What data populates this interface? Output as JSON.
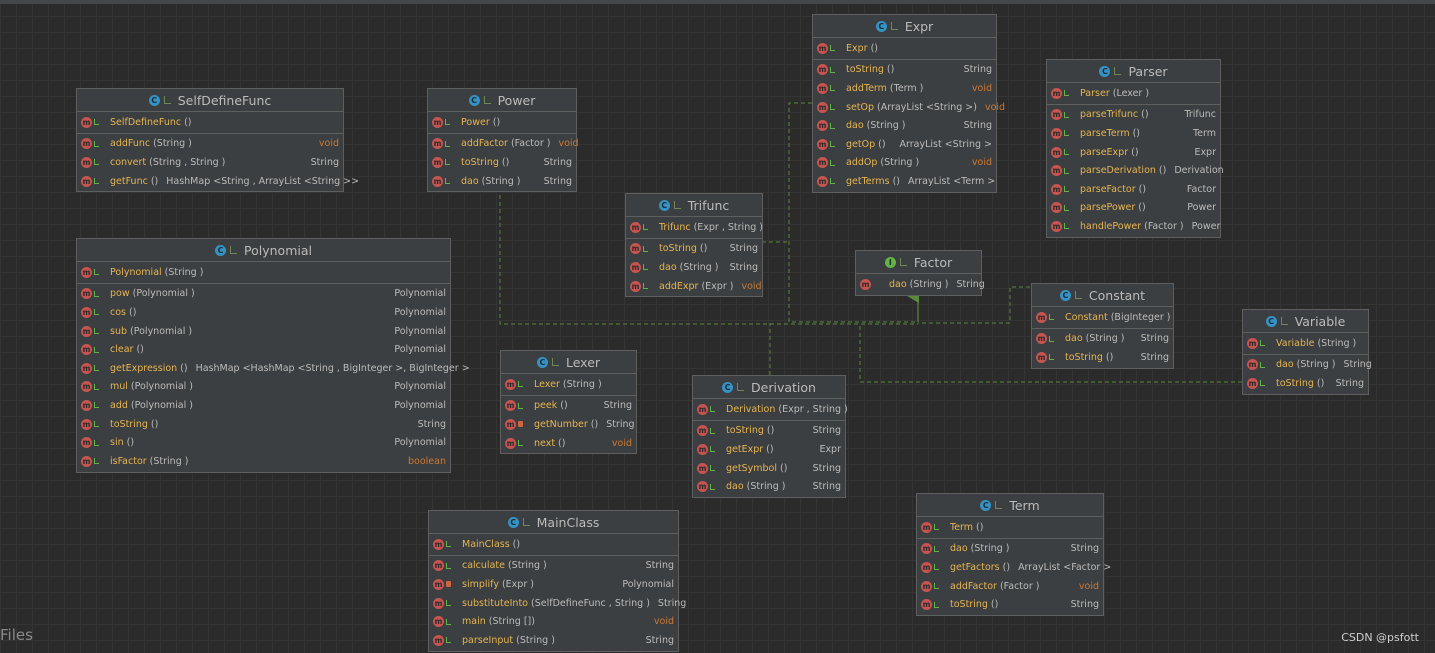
{
  "footer": {
    "left_label": "Files",
    "watermark": "CSDN @psfott"
  },
  "colors": {
    "canvas": "#2b2b2b",
    "node": "#3c3f41",
    "method_name": "#e6b450",
    "void_return": "#cc7832",
    "class_badge": "#3592c4",
    "interface_badge": "#62b543",
    "edge": "#5a8a3c"
  },
  "classes": [
    {
      "id": "selfdefinefunc",
      "kind": "C",
      "name": "SelfDefineFunc",
      "ctor": [
        {
          "name": "SelfDefineFunc",
          "sig": "()",
          "ret": "",
          "acc": "pub"
        }
      ],
      "methods": [
        {
          "name": "addFunc",
          "sig": "(String )",
          "ret": "void",
          "acc": "pub"
        },
        {
          "name": "convert",
          "sig": "(String , String )",
          "ret": "String",
          "acc": "pub"
        },
        {
          "name": "getFunc",
          "sig": "()",
          "ret": "HashMap <String , ArrayList <String >>",
          "acc": "pub"
        }
      ]
    },
    {
      "id": "power",
      "kind": "C",
      "name": "Power",
      "ctor": [
        {
          "name": "Power",
          "sig": "()",
          "ret": "",
          "acc": "pub"
        }
      ],
      "methods": [
        {
          "name": "addFactor",
          "sig": "(Factor )",
          "ret": "void",
          "acc": "pub"
        },
        {
          "name": "toString",
          "sig": "()",
          "ret": "String",
          "acc": "pub"
        },
        {
          "name": "dao",
          "sig": "(String )",
          "ret": "String",
          "acc": "pub"
        }
      ]
    },
    {
      "id": "expr",
      "kind": "C",
      "name": "Expr",
      "ctor": [
        {
          "name": "Expr",
          "sig": "()",
          "ret": "",
          "acc": "pub"
        }
      ],
      "methods": [
        {
          "name": "toString",
          "sig": "()",
          "ret": "String",
          "acc": "pub"
        },
        {
          "name": "addTerm",
          "sig": "(Term )",
          "ret": "void",
          "acc": "pub"
        },
        {
          "name": "setOp",
          "sig": "(ArrayList <String >)",
          "ret": "void",
          "acc": "pub"
        },
        {
          "name": "dao",
          "sig": "(String )",
          "ret": "String",
          "acc": "pub"
        },
        {
          "name": "getOp",
          "sig": "()",
          "ret": "ArrayList <String >",
          "acc": "pub"
        },
        {
          "name": "addOp",
          "sig": "(String )",
          "ret": "void",
          "acc": "pub"
        },
        {
          "name": "getTerms",
          "sig": "()",
          "ret": "ArrayList <Term >",
          "acc": "pub"
        }
      ]
    },
    {
      "id": "parser",
      "kind": "C",
      "name": "Parser",
      "ctor": [
        {
          "name": "Parser",
          "sig": "(Lexer )",
          "ret": "",
          "acc": "pub"
        }
      ],
      "methods": [
        {
          "name": "parseTrifunc",
          "sig": "()",
          "ret": "Trifunc",
          "acc": "pub"
        },
        {
          "name": "parseTerm",
          "sig": "()",
          "ret": "Term",
          "acc": "pub"
        },
        {
          "name": "parseExpr",
          "sig": "()",
          "ret": "Expr",
          "acc": "pub"
        },
        {
          "name": "parseDerivation",
          "sig": "()",
          "ret": "Derivation",
          "acc": "pub"
        },
        {
          "name": "parseFactor",
          "sig": "()",
          "ret": "Factor",
          "acc": "pub"
        },
        {
          "name": "parsePower",
          "sig": "()",
          "ret": "Power",
          "acc": "pub"
        },
        {
          "name": "handlePower",
          "sig": "(Factor )",
          "ret": "Power",
          "acc": "pub"
        }
      ]
    },
    {
      "id": "trifunc",
      "kind": "C",
      "name": "Trifunc",
      "ctor": [
        {
          "name": "Trifunc",
          "sig": "(Expr , String )",
          "ret": "",
          "acc": "pub"
        }
      ],
      "methods": [
        {
          "name": "toString",
          "sig": "()",
          "ret": "String",
          "acc": "pub"
        },
        {
          "name": "dao",
          "sig": "(String )",
          "ret": "String",
          "acc": "pub"
        },
        {
          "name": "addExpr",
          "sig": "(Expr )",
          "ret": "void",
          "acc": "pub"
        }
      ]
    },
    {
      "id": "factor",
      "kind": "I",
      "name": "Factor",
      "ctor": [],
      "methods": [
        {
          "name": "dao",
          "sig": "(String )",
          "ret": "String",
          "acc": "none"
        }
      ]
    },
    {
      "id": "polynomial",
      "kind": "C",
      "name": "Polynomial",
      "ctor": [
        {
          "name": "Polynomial",
          "sig": "(String )",
          "ret": "",
          "acc": "pub"
        }
      ],
      "methods": [
        {
          "name": "pow",
          "sig": "(Polynomial )",
          "ret": "Polynomial",
          "acc": "pub"
        },
        {
          "name": "cos",
          "sig": "()",
          "ret": "Polynomial",
          "acc": "pub"
        },
        {
          "name": "sub",
          "sig": "(Polynomial )",
          "ret": "Polynomial",
          "acc": "pub"
        },
        {
          "name": "clear",
          "sig": "()",
          "ret": "Polynomial",
          "acc": "pub"
        },
        {
          "name": "getExpression",
          "sig": "()",
          "ret": "HashMap <HashMap <String , BigInteger >, BigInteger >",
          "acc": "pub"
        },
        {
          "name": "mul",
          "sig": "(Polynomial )",
          "ret": "Polynomial",
          "acc": "pub"
        },
        {
          "name": "add",
          "sig": "(Polynomial )",
          "ret": "Polynomial",
          "acc": "pub"
        },
        {
          "name": "toString",
          "sig": "()",
          "ret": "String",
          "acc": "pub"
        },
        {
          "name": "sin",
          "sig": "()",
          "ret": "Polynomial",
          "acc": "pub"
        },
        {
          "name": "isFactor",
          "sig": "(String )",
          "ret": "boolean",
          "acc": "pub"
        }
      ]
    },
    {
      "id": "constant",
      "kind": "C",
      "name": "Constant",
      "ctor": [
        {
          "name": "Constant",
          "sig": "(BigInteger )",
          "ret": "",
          "acc": "pub"
        }
      ],
      "methods": [
        {
          "name": "dao",
          "sig": "(String )",
          "ret": "String",
          "acc": "pub"
        },
        {
          "name": "toString",
          "sig": "()",
          "ret": "String",
          "acc": "pub"
        }
      ]
    },
    {
      "id": "variable",
      "kind": "C",
      "name": "Variable",
      "ctor": [
        {
          "name": "Variable",
          "sig": "(String )",
          "ret": "",
          "acc": "pub"
        }
      ],
      "methods": [
        {
          "name": "dao",
          "sig": "(String )",
          "ret": "String",
          "acc": "pub"
        },
        {
          "name": "toString",
          "sig": "()",
          "ret": "String",
          "acc": "pub"
        }
      ]
    },
    {
      "id": "lexer",
      "kind": "C",
      "name": "Lexer",
      "ctor": [
        {
          "name": "Lexer",
          "sig": "(String )",
          "ret": "",
          "acc": "pub"
        }
      ],
      "methods": [
        {
          "name": "peek",
          "sig": "()",
          "ret": "String",
          "acc": "pub"
        },
        {
          "name": "getNumber",
          "sig": "()",
          "ret": "String",
          "acc": "priv"
        },
        {
          "name": "next",
          "sig": "()",
          "ret": "void",
          "acc": "pub"
        }
      ]
    },
    {
      "id": "derivation",
      "kind": "C",
      "name": "Derivation",
      "ctor": [
        {
          "name": "Derivation",
          "sig": "(Expr , String )",
          "ret": "",
          "acc": "pub"
        }
      ],
      "methods": [
        {
          "name": "toString",
          "sig": "()",
          "ret": "String",
          "acc": "pub"
        },
        {
          "name": "getExpr",
          "sig": "()",
          "ret": "Expr",
          "acc": "pub"
        },
        {
          "name": "getSymbol",
          "sig": "()",
          "ret": "String",
          "acc": "pub"
        },
        {
          "name": "dao",
          "sig": "(String )",
          "ret": "String",
          "acc": "pub"
        }
      ]
    },
    {
      "id": "mainclass",
      "kind": "C",
      "name": "MainClass",
      "ctor": [
        {
          "name": "MainClass",
          "sig": "()",
          "ret": "",
          "acc": "pub"
        }
      ],
      "methods": [
        {
          "name": "calculate",
          "sig": "(String )",
          "ret": "String",
          "acc": "pub"
        },
        {
          "name": "simplify",
          "sig": "(Expr )",
          "ret": "Polynomial",
          "acc": "priv"
        },
        {
          "name": "substituteInto",
          "sig": "(SelfDefineFunc , String )",
          "ret": "String",
          "acc": "pub"
        },
        {
          "name": "main",
          "sig": "(String [])",
          "ret": "void",
          "acc": "pub"
        },
        {
          "name": "parseInput",
          "sig": "(String )",
          "ret": "String",
          "acc": "pub"
        }
      ]
    },
    {
      "id": "term",
      "kind": "C",
      "name": "Term",
      "ctor": [
        {
          "name": "Term",
          "sig": "()",
          "ret": "",
          "acc": "pub"
        }
      ],
      "methods": [
        {
          "name": "dao",
          "sig": "(String )",
          "ret": "String",
          "acc": "pub"
        },
        {
          "name": "getFactors",
          "sig": "()",
          "ret": "ArrayList <Factor >",
          "acc": "pub"
        },
        {
          "name": "addFactor",
          "sig": "(Factor )",
          "ret": "void",
          "acc": "pub"
        },
        {
          "name": "toString",
          "sig": "()",
          "ret": "String",
          "acc": "pub"
        }
      ]
    }
  ]
}
